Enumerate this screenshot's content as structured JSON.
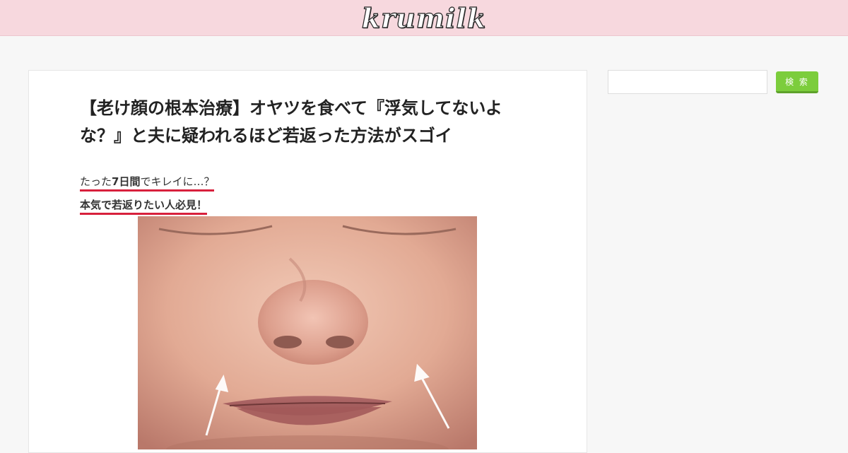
{
  "header": {
    "logo_text": "krumilk",
    "background_color": "#f7d8de"
  },
  "article": {
    "title": "【老け顔の根本治療】オヤツを食べて『浮気してないよな？』と夫に疑われるほど若返った方法がスゴイ",
    "subtitle_1_prefix": "たった",
    "subtitle_1_bold": "7日間",
    "subtitle_1_suffix": "でキレイに…？",
    "subtitle_2": "本気で若返りたい人必見！",
    "underline_color": "#d8203c"
  },
  "sidebar": {
    "search_value": "",
    "search_button_label": "検 索",
    "button_color": "#7ccd3c"
  }
}
